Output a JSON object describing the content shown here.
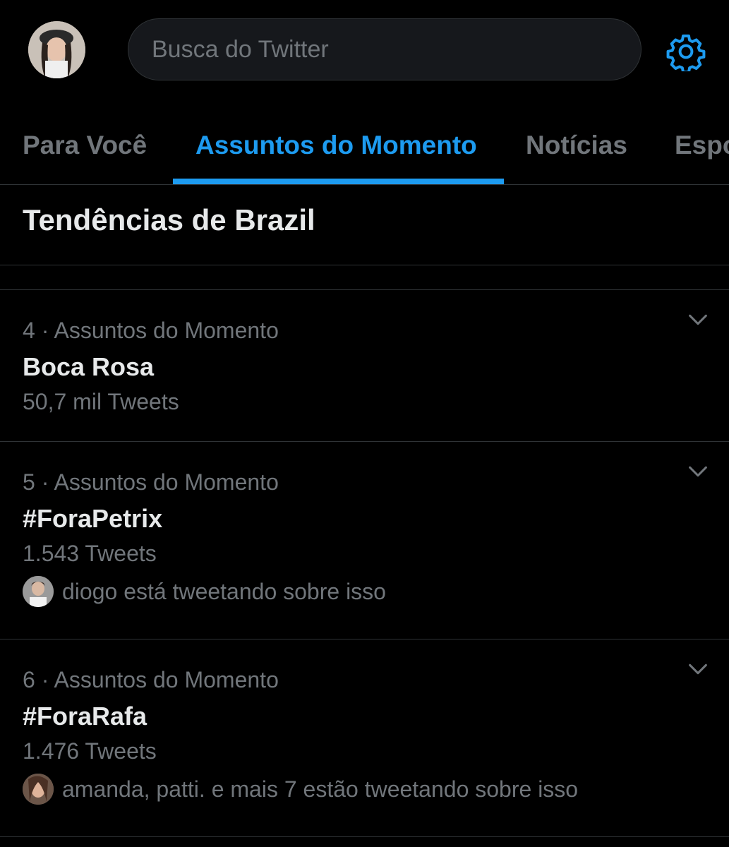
{
  "header": {
    "search_placeholder": "Busca do Twitter",
    "avatar_icon": "user-avatar",
    "settings_icon": "gear-icon"
  },
  "tabs": [
    {
      "label": "Para Você",
      "active": false
    },
    {
      "label": "Assuntos do Momento",
      "active": true
    },
    {
      "label": "Notícias",
      "active": false
    },
    {
      "label": "Esportes",
      "active": false
    }
  ],
  "section": {
    "title": "Tendências de Brazil"
  },
  "trends": [
    {
      "meta": "4 · Assuntos do Momento",
      "name": "Boca Rosa",
      "count": "50,7 mil Tweets",
      "who": ""
    },
    {
      "meta": "5 · Assuntos do Momento",
      "name": "#ForaPetrix",
      "count": "1.543 Tweets",
      "who": "diogo está tweetando sobre isso"
    },
    {
      "meta": "6 · Assuntos do Momento",
      "name": "#ForaRafa",
      "count": "1.476 Tweets",
      "who": "amanda, patti. e mais 7 estão tweetando sobre isso"
    }
  ],
  "colors": {
    "accent": "#1d9bf0",
    "background": "#000000",
    "muted": "#71767b",
    "border": "#2f3336"
  }
}
